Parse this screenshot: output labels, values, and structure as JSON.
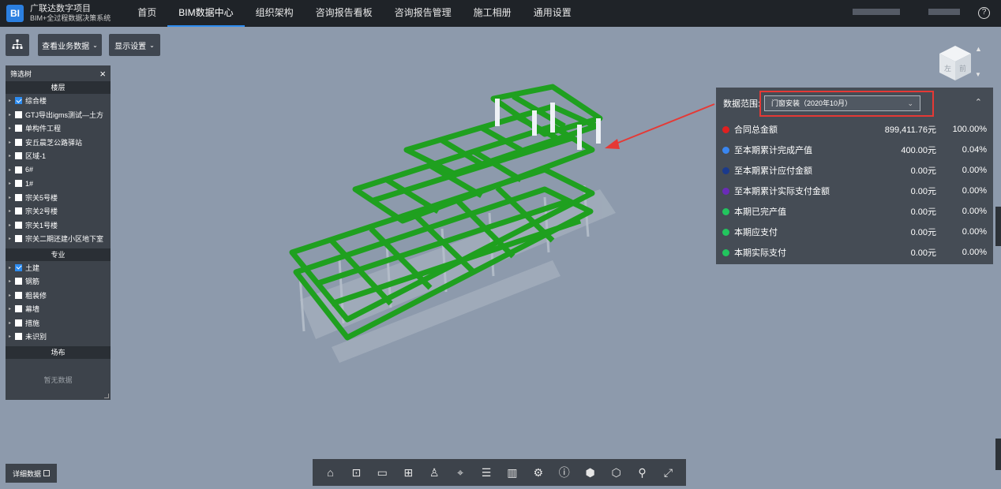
{
  "header": {
    "brand_title": "广联达数字项目",
    "brand_subtitle": "BIM+全过程数据决策系统",
    "logo_text": "BI",
    "nav": [
      {
        "label": "首页"
      },
      {
        "label": "BIM数据中心"
      },
      {
        "label": "组织架构"
      },
      {
        "label": "咨询报告看板"
      },
      {
        "label": "咨询报告管理"
      },
      {
        "label": "施工相册"
      },
      {
        "label": "通用设置"
      }
    ],
    "help_glyph": "?"
  },
  "toolbar": {
    "view_business_data": "查看业务数据",
    "display_settings": "显示设置"
  },
  "filter_tree": {
    "title": "筛选树",
    "close_glyph": "×",
    "floors_title": "楼层",
    "floors": [
      {
        "label": "综合楼",
        "checked": true
      },
      {
        "label": "GTJ导出igms测试—土方",
        "checked": false
      },
      {
        "label": "单构件工程",
        "checked": false
      },
      {
        "label": "安丘晨芝公路驿站",
        "checked": false
      },
      {
        "label": "区域-1",
        "checked": false
      },
      {
        "label": "6#",
        "checked": false
      },
      {
        "label": "1#",
        "checked": false
      },
      {
        "label": "宗关5号楼",
        "checked": false
      },
      {
        "label": "宗关2号楼",
        "checked": false
      },
      {
        "label": "宗关1号楼",
        "checked": false
      },
      {
        "label": "宗关二期还建小区地下室",
        "checked": false
      }
    ],
    "discipline_title": "专业",
    "disciplines": [
      {
        "label": "土建",
        "checked": true
      },
      {
        "label": "钢筋",
        "checked": false
      },
      {
        "label": "粗装修",
        "checked": false
      },
      {
        "label": "幕墙",
        "checked": false
      },
      {
        "label": "措施",
        "checked": false
      },
      {
        "label": "未识别",
        "checked": false
      }
    ],
    "site_title": "场布",
    "site_empty": "暂无数据"
  },
  "data_panel": {
    "range_label": "数据范围:",
    "range_value": "门窗安装（2020年10月）",
    "rows": [
      {
        "label": "合同总金额",
        "amount": "899,411.76元",
        "percent": "100.00%",
        "color": "#e02020"
      },
      {
        "label": "至本期累计完成产值",
        "amount": "400.00元",
        "percent": "0.04%",
        "color": "#3a86f0"
      },
      {
        "label": "至本期累计应付金额",
        "amount": "0.00元",
        "percent": "0.00%",
        "color": "#1b3a8c"
      },
      {
        "label": "至本期累计实际支付金额",
        "amount": "0.00元",
        "percent": "0.00%",
        "color": "#6a2bb8"
      },
      {
        "label": "本期已完产值",
        "amount": "0.00元",
        "percent": "0.00%",
        "color": "#22c55e"
      },
      {
        "label": "本期应支付",
        "amount": "0.00元",
        "percent": "0.00%",
        "color": "#22c55e"
      },
      {
        "label": "本期实际支付",
        "amount": "0.00元",
        "percent": "0.00%",
        "color": "#22c55e"
      }
    ]
  },
  "viewcube": {
    "face_left": "左",
    "face_right": "前"
  },
  "detail_button": "详细数据",
  "bottom_tools": [
    "home-icon",
    "zoom-region-icon",
    "measure-icon",
    "section-icon",
    "person-icon",
    "location-pin-icon",
    "list-icon",
    "chart-icon",
    "gear-icon",
    "info-icon",
    "cube-icon",
    "box-icon",
    "map-pin-icon",
    "fullscreen-icon"
  ]
}
